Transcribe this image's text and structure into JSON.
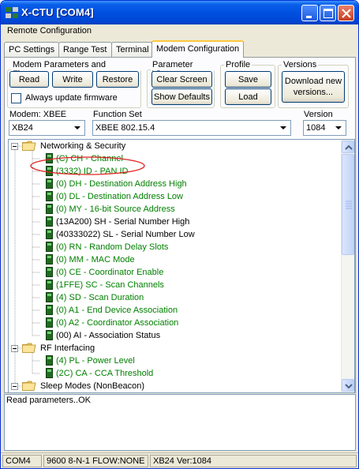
{
  "window": {
    "title": "X-CTU  [COM4]"
  },
  "menu": {
    "remote_config": "Remote Configuration"
  },
  "tabs": [
    {
      "label": "PC Settings"
    },
    {
      "label": "Range Test"
    },
    {
      "label": "Terminal"
    },
    {
      "label": "Modem Configuration",
      "active": true
    }
  ],
  "modem_params": {
    "legend": "Modem Parameters and Firmware",
    "read": "Read",
    "write": "Write",
    "restore": "Restore",
    "always_update": "Always update firmware",
    "always_update_checked": false
  },
  "param_view": {
    "legend": "Parameter View",
    "clear": "Clear Screen",
    "defaults": "Show Defaults"
  },
  "profile": {
    "legend": "Profile",
    "save": "Save",
    "load": "Load"
  },
  "versions": {
    "legend": "Versions",
    "download_line1": "Download new",
    "download_line2": "versions..."
  },
  "modem": {
    "label": "Modem: XBEE",
    "value": "XB24"
  },
  "function_set": {
    "label": "Function Set",
    "value": "XBEE 802.15.4"
  },
  "version": {
    "label": "Version",
    "value": "1084"
  },
  "tree": {
    "groups": [
      {
        "label": "Networking & Security",
        "expanded": true,
        "items": [
          {
            "text": "(C) CH - Channel",
            "color": "green"
          },
          {
            "text": "(3332) ID - PAN ID",
            "color": "green",
            "circled": true
          },
          {
            "text": "(0) DH - Destination Address High",
            "color": "green"
          },
          {
            "text": "(0) DL - Destination Address Low",
            "color": "green"
          },
          {
            "text": "(0) MY - 16-bit Source Address",
            "color": "green"
          },
          {
            "text": "(13A200) SH - Serial Number High",
            "color": "black"
          },
          {
            "text": "(40333022) SL - Serial Number Low",
            "color": "black"
          },
          {
            "text": "(0) RN - Random Delay Slots",
            "color": "green"
          },
          {
            "text": "(0) MM - MAC Mode",
            "color": "green"
          },
          {
            "text": "(0) CE - Coordinator Enable",
            "color": "green"
          },
          {
            "text": "(1FFE) SC - Scan Channels",
            "color": "green"
          },
          {
            "text": "(4) SD - Scan Duration",
            "color": "green"
          },
          {
            "text": "(0) A1 - End Device Association",
            "color": "green"
          },
          {
            "text": "(0) A2 - Coordinator Association",
            "color": "green"
          },
          {
            "text": "(00) AI - Association Status",
            "color": "black"
          }
        ]
      },
      {
        "label": "RF Interfacing",
        "expanded": true,
        "items": [
          {
            "text": "(4) PL - Power Level",
            "color": "green"
          },
          {
            "text": "(2C) CA - CCA Threshold",
            "color": "green"
          }
        ]
      },
      {
        "label": "Sleep Modes (NonBeacon)",
        "expanded": true,
        "items": []
      }
    ]
  },
  "status_message": "Read parameters..OK",
  "statusbar": {
    "port": "COM4",
    "settings": "9600 8-N-1  FLOW:NONE",
    "modem": "XB24  Ver:1084"
  },
  "colors": {
    "green_text": "#008000",
    "title_blue": "#0050e0",
    "annotation_red": "#e02020"
  }
}
